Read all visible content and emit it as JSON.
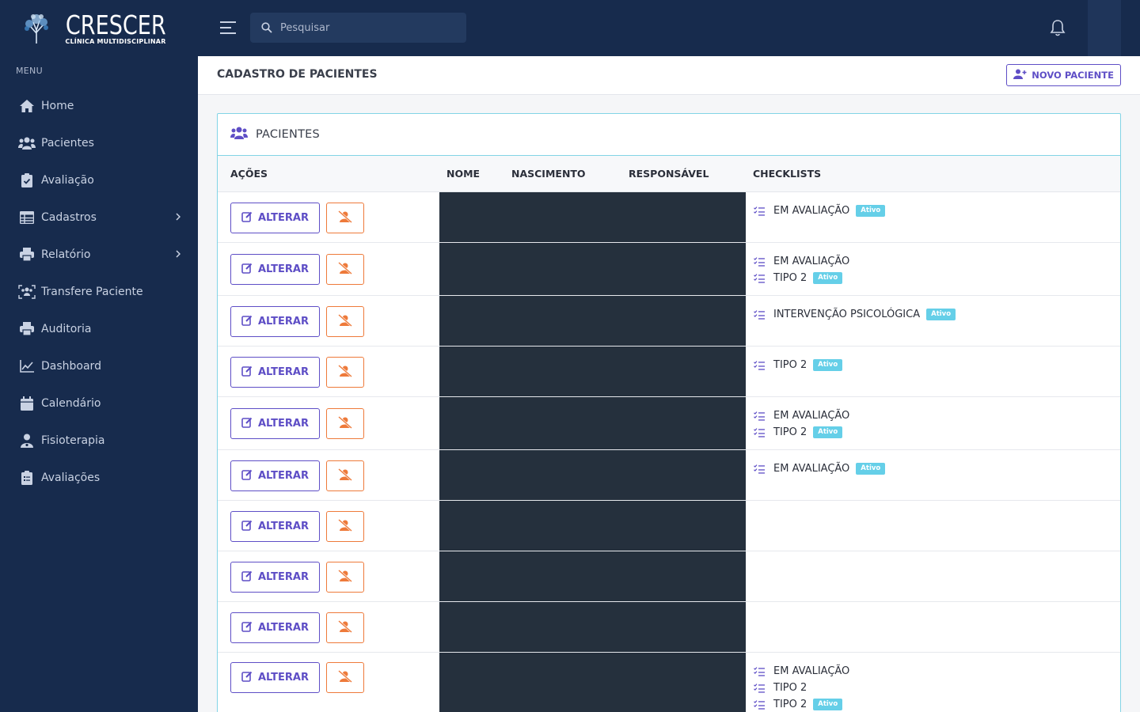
{
  "logo": {
    "title": "CRESCER",
    "subtitle": "CLÍNICA MULTIDISCIPLINAR"
  },
  "sidebar": {
    "menu_label": "MENU",
    "items": [
      {
        "label": "Home",
        "icon": "home-icon"
      },
      {
        "label": "Pacientes",
        "icon": "users-icon"
      },
      {
        "label": "Avaliação",
        "icon": "clipboard-check-icon"
      },
      {
        "label": "Cadastros",
        "icon": "table-icon",
        "has_children": true
      },
      {
        "label": "Relatório",
        "icon": "printer-icon",
        "has_children": true
      },
      {
        "label": "Transfere Paciente",
        "icon": "users-transfer-icon"
      },
      {
        "label": "Auditoria",
        "icon": "printer-icon"
      },
      {
        "label": "Dashboard",
        "icon": "line-chart-icon"
      },
      {
        "label": "Calendário",
        "icon": "calendar-icon"
      },
      {
        "label": "Fisioterapia",
        "icon": "user-medical-icon"
      },
      {
        "label": "Avaliações",
        "icon": "clipboard-list-icon"
      }
    ]
  },
  "topbar": {
    "search_placeholder": "Pesquisar"
  },
  "page": {
    "title": "CADASTRO DE PACIENTES",
    "new_button": "NOVO PACIENTE"
  },
  "card": {
    "title": "PACIENTES",
    "columns": [
      "AÇÕES",
      "NOME",
      "NASCIMENTO",
      "RESPONSÁVEL",
      "CHECKLISTS"
    ],
    "alter_label": "ALTERAR",
    "badge_label": "Ativo",
    "rows": [
      {
        "checklists": [
          {
            "name": "EM AVALIAÇÃO",
            "active": true
          }
        ]
      },
      {
        "checklists": [
          {
            "name": "EM AVALIAÇÃO",
            "active": false
          },
          {
            "name": "TIPO 2",
            "active": true
          }
        ]
      },
      {
        "checklists": [
          {
            "name": "INTERVENÇÃO PSICOLÓGICA",
            "active": true
          }
        ]
      },
      {
        "checklists": [
          {
            "name": "TIPO 2",
            "active": true
          }
        ]
      },
      {
        "checklists": [
          {
            "name": "EM AVALIAÇÃO",
            "active": false
          },
          {
            "name": "TIPO 2",
            "active": true
          }
        ]
      },
      {
        "checklists": [
          {
            "name": "EM AVALIAÇÃO",
            "active": true
          }
        ]
      },
      {
        "checklists": []
      },
      {
        "checklists": []
      },
      {
        "checklists": []
      },
      {
        "checklists": [
          {
            "name": "EM AVALIAÇÃO",
            "active": false
          },
          {
            "name": "TIPO 2",
            "active": false
          },
          {
            "name": "TIPO 2",
            "active": true
          }
        ]
      }
    ]
  },
  "colors": {
    "sidebar": "#172b4d",
    "accent": "#5e4ec6",
    "danger": "#ee7a3a",
    "badge": "#65cfe8",
    "card_border": "#82d4e6"
  }
}
